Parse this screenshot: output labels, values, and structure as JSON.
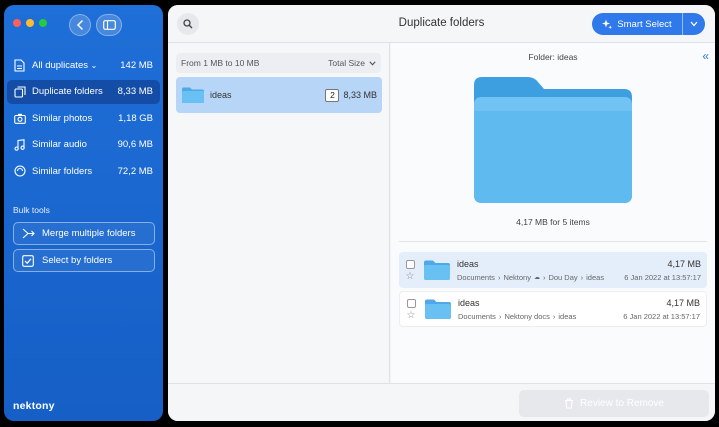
{
  "sidebar": {
    "items": [
      {
        "label": "All duplicates",
        "size": "142 MB"
      },
      {
        "label": "Duplicate folders",
        "size": "8,33 MB"
      },
      {
        "label": "Similar photos",
        "size": "1,18 GB"
      },
      {
        "label": "Similar audio",
        "size": "90,6 MB"
      },
      {
        "label": "Similar folders",
        "size": "72,2 MB"
      }
    ],
    "bulk_title": "Bulk tools",
    "bulk_merge": "Merge multiple folders",
    "bulk_select": "Select by folders",
    "logo": "nektony"
  },
  "header": {
    "title": "Duplicate folders",
    "smart_select": "Smart Select"
  },
  "left_pane": {
    "range": "From 1 MB to 10 MB",
    "sort": "Total Size",
    "row": {
      "name": "ideas",
      "count": "2",
      "size": "8,33 MB"
    }
  },
  "right_pane": {
    "folder_label": "Folder: ideas",
    "summary": "4,17 MB for 5 items",
    "files": [
      {
        "name": "ideas",
        "path": [
          "Documents",
          "Nektony",
          "Dou Day",
          "ideas"
        ],
        "size": "4,17 MB",
        "date": "6 Jan 2022 at 13:57:17"
      },
      {
        "name": "ideas",
        "path": [
          "Documents",
          "Nektony docs",
          "ideas"
        ],
        "size": "4,17 MB",
        "date": "6 Jan 2022 at 13:57:17"
      }
    ]
  },
  "footer": {
    "review": "Review to Remove"
  },
  "colors": {
    "sidebar": "#1f6fd8",
    "accent": "#2f79ea",
    "folder": "#5eb8ef",
    "selected_row": "#b7d5f7"
  },
  "icons": {
    "back": "chevron-left-icon",
    "sidebar_toggle": "sidebar-icon",
    "search": "search-icon",
    "smart": "sparkle-icon",
    "collapse": "double-chevron-left-icon",
    "trash": "trash-icon"
  }
}
